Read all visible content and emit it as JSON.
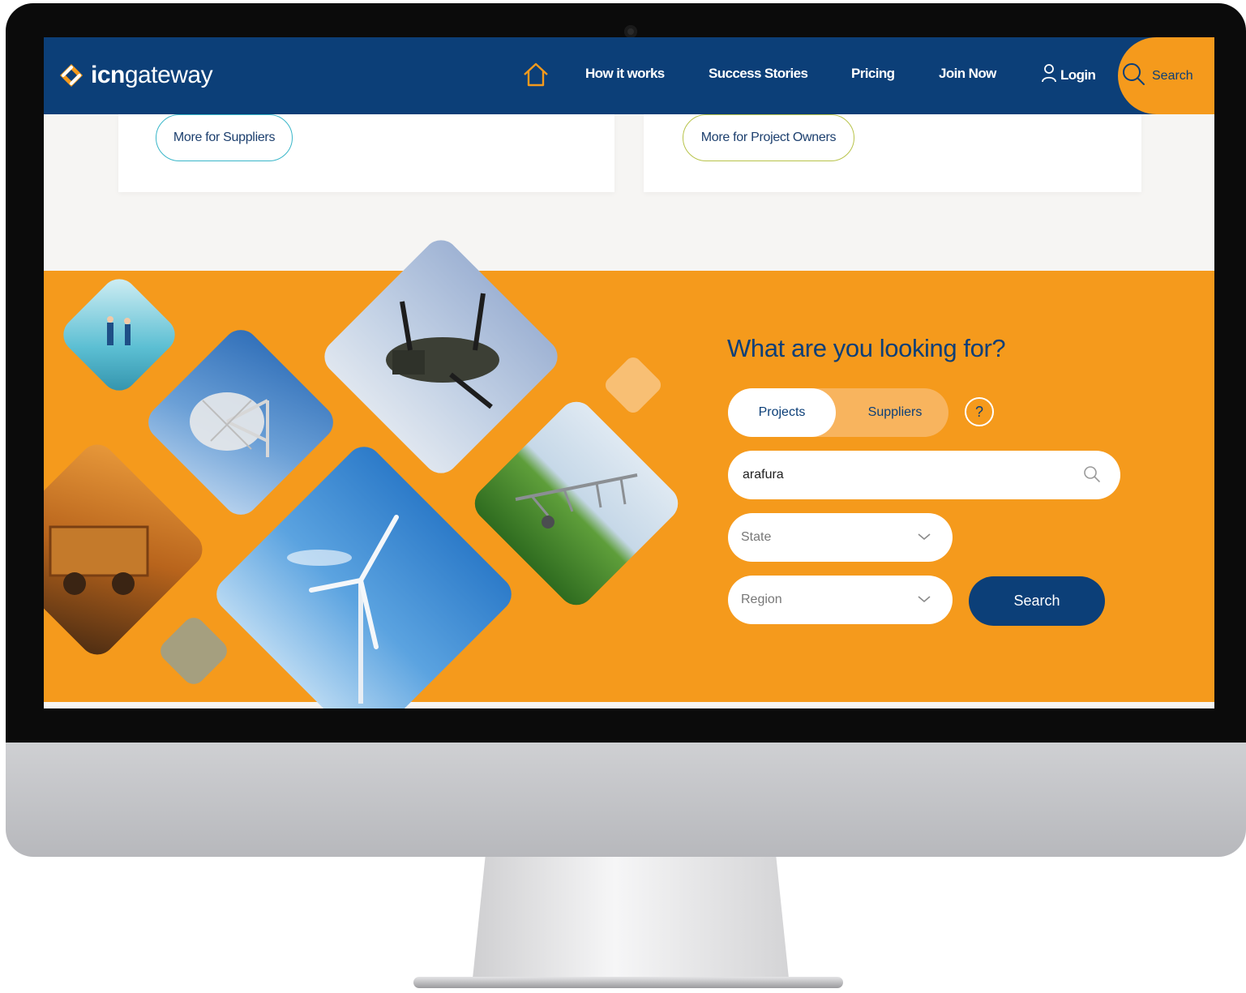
{
  "logo": {
    "brand_bold": "icn",
    "brand_light": "gateway"
  },
  "nav": {
    "items": [
      "How it works",
      "Success Stories",
      "Pricing",
      "Join Now"
    ],
    "login": "Login",
    "search": "Search"
  },
  "cards": {
    "suppliers_button": "More for Suppliers",
    "owners_button": "More for Project Owners"
  },
  "search_panel": {
    "heading": "What are you looking for?",
    "tabs": [
      "Projects",
      "Suppliers"
    ],
    "active_tab": "Projects",
    "help": "?",
    "keyword_value": "arafura",
    "state_placeholder": "State",
    "region_placeholder": "Region",
    "submit": "Search"
  },
  "colors": {
    "navy": "#0c3f78",
    "orange": "#f59a1c",
    "suppliers_outline": "#39b6c9",
    "owners_outline": "#b8c34a"
  }
}
